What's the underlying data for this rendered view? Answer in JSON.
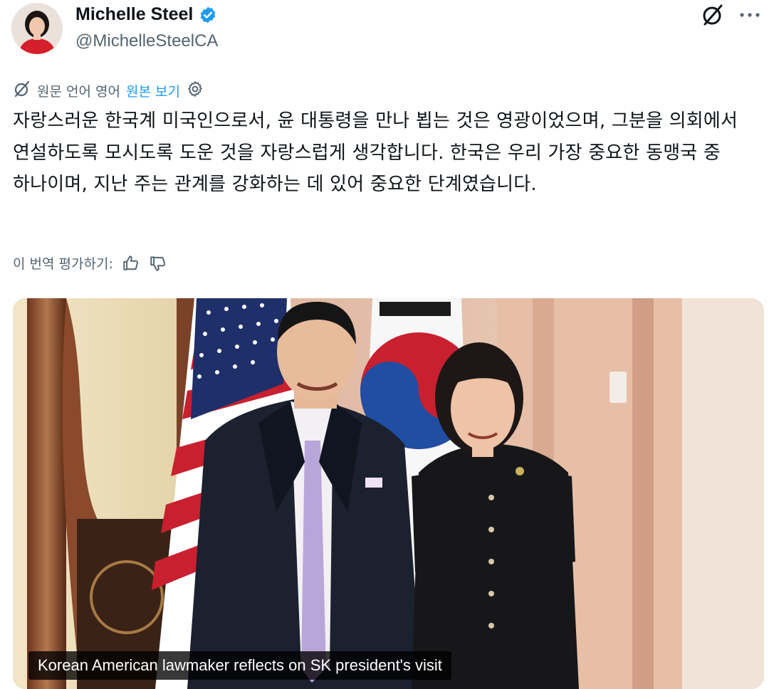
{
  "author": {
    "name": "Michelle Steel",
    "handle": "@MichelleSteelCA",
    "verified": true,
    "avatar_icon": "profile-photo"
  },
  "actions": {
    "grok_icon": "slash-circle-icon",
    "more_icon": "ellipsis-icon"
  },
  "translation": {
    "prefix": "원문 언어 영어",
    "show_original": "원본 보기",
    "settings_icon": "gear-icon"
  },
  "post": {
    "text": "자랑스러운 한국계 미국인으로서, 윤 대통령을 만나 뵙는 것은 영광이었으며, 그분을 의회에서 연설하도록 모시도록 도운 것을 자랑스럽게 생각합니다. 한국은 우리 가장 중요한 동맹국 중 하나이며, 지난 주는 관계를 강화하는 데 있어 중요한 단계였습니다."
  },
  "rating": {
    "label": "이 번역 평가하기:",
    "thumbs_up_icon": "thumbs-up-icon",
    "thumbs_down_icon": "thumbs-down-icon"
  },
  "media": {
    "caption": "Korean American lawmaker reflects on SK president's visit"
  },
  "colors": {
    "text": "#0f1419",
    "secondary": "#536471",
    "link": "#1d9bf0",
    "verified": "#1d9bf0"
  }
}
